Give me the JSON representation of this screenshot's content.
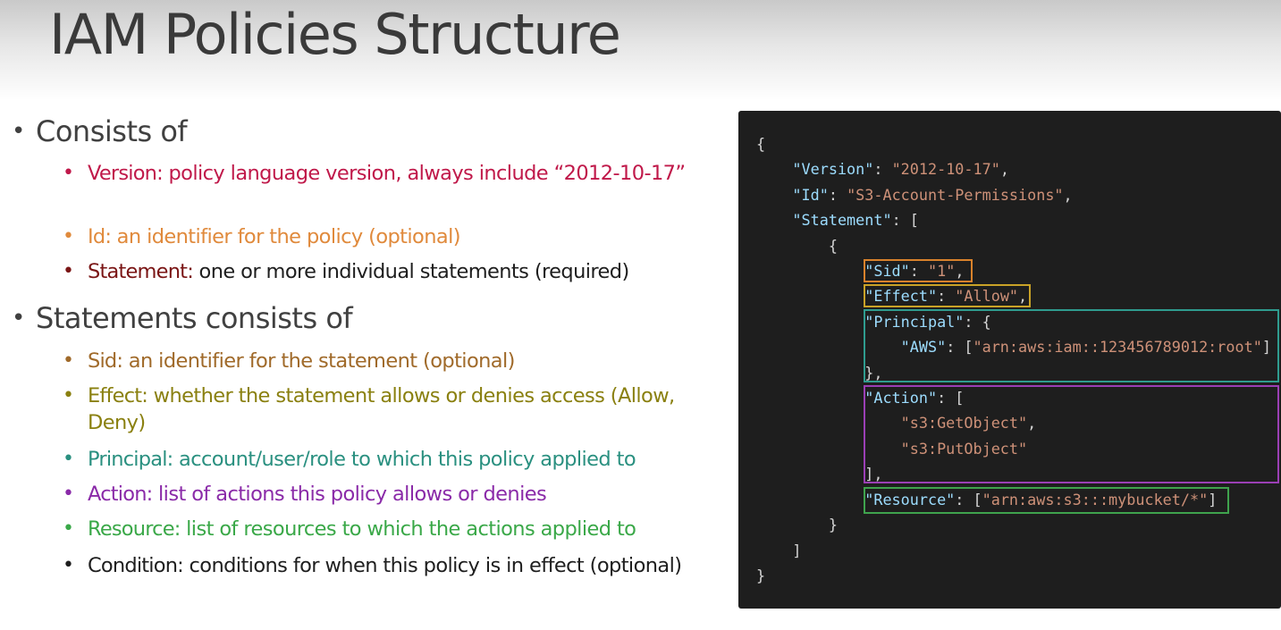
{
  "title": "IAM Policies Structure",
  "section1": {
    "heading": "Consists of",
    "items": [
      {
        "label": "Version:",
        "text": "policy language version, always include “2012-10-17”",
        "color": "#c0194a"
      },
      {
        "label": "Id:",
        "text": "an identifier for the policy (optional)",
        "color": "#e08a3c"
      },
      {
        "label": "Statement:",
        "text": "one or more individual statements (required)",
        "color": "#7a1515"
      }
    ]
  },
  "section2": {
    "heading": "Statements consists of",
    "items": [
      {
        "label": "Sid:",
        "text": "an identifier for the statement (optional)",
        "color": "#a06a2a"
      },
      {
        "label": "Effect:",
        "text": "whether the statement allows or denies access (Allow, Deny)",
        "color": "#8a8010"
      },
      {
        "label": "Principal:",
        "text": "account/user/role to which this policy applied to",
        "color": "#2a9080"
      },
      {
        "label": "Action:",
        "text": "list of actions this policy allows or denies",
        "color": "#8a2aa8"
      },
      {
        "label": "Resource:",
        "text": "list of resources to which the actions applied to",
        "color": "#3aa848"
      },
      {
        "label": "Condition:",
        "text": "conditions for when this policy is in effect (optional)",
        "color": "#1e1e1e"
      }
    ]
  },
  "policy_json": {
    "open_brace": "{",
    "version_key": "\"Version\"",
    "version_value": "\"2012-10-17\"",
    "id_key": "\"Id\"",
    "id_value": "\"S3-Account-Permissions\"",
    "statement_key": "\"Statement\"",
    "inner_open": "{",
    "sid_key": "\"Sid\"",
    "sid_value": "\"1\"",
    "effect_key": "\"Effect\"",
    "effect_value": "\"Allow\"",
    "principal_key": "\"Principal\"",
    "aws_key": "\"AWS\"",
    "aws_value": "\"arn:aws:iam::123456789012:root\"",
    "action_key": "\"Action\"",
    "action_1": "\"s3:GetObject\"",
    "action_2": "\"s3:PutObject\"",
    "resource_key": "\"Resource\"",
    "resource_value": "\"arn:aws:s3:::mybucket/*\"",
    "inner_close": "}",
    "array_close": "]",
    "close_brace": "}"
  },
  "highlight_colors": {
    "sid": "#d9822b",
    "effect": "#c9a227",
    "principal": "#2f9c8f",
    "action": "#9b3fb5",
    "resource": "#3fa34d"
  }
}
